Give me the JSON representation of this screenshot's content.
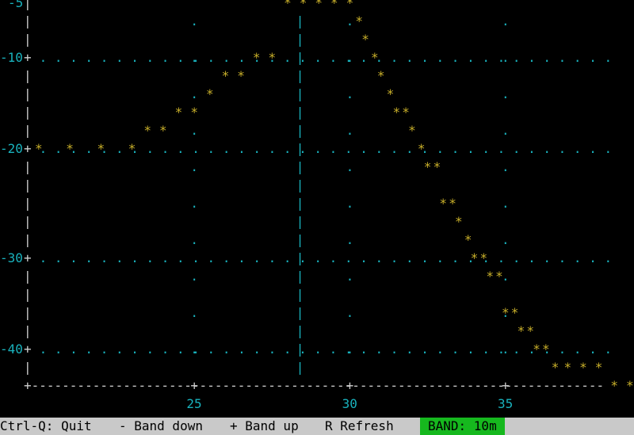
{
  "colors": {
    "background": "#000000",
    "axis": "#cfcfcf",
    "tick_labels": "#19b2bd",
    "grid_dots": "#19b2bd",
    "curve": "#c9b02a",
    "marker": "#19b2bd",
    "status_bar": "#c9c9c9",
    "band_badge": "#16b81e"
  },
  "chart_data": {
    "type": "line",
    "rendering": "ascii",
    "title": "",
    "xlabel": "",
    "ylabel": "",
    "x_ticks": [
      "25",
      "30",
      "35"
    ],
    "y_ticks": [
      "-5",
      "-10",
      "-20",
      "-30",
      "-40"
    ],
    "xlim": [
      20,
      39
    ],
    "ylim": [
      -43,
      -5
    ],
    "grid": "dotted",
    "marker_x": 28.4,
    "series": [
      {
        "x": [
          20.0,
          21.0,
          22.0,
          23.0,
          23.5,
          24.0,
          24.5,
          25.0,
          25.5,
          26.0,
          26.5,
          27.0,
          27.5,
          28.0,
          28.5,
          29.0,
          29.5,
          30.0,
          30.3,
          30.5,
          30.8,
          31.0,
          31.3,
          31.5,
          31.8,
          32.0,
          32.3,
          32.5,
          32.8,
          33.0,
          33.3,
          33.5,
          33.8,
          34.0,
          34.3,
          34.5,
          34.8,
          35.0,
          35.3,
          35.5,
          35.8,
          36.0,
          36.3,
          36.6,
          37.0,
          37.5,
          38.0,
          38.5,
          39.0
        ],
        "y": [
          -20,
          -20,
          -20,
          -19,
          -18,
          -17,
          -16,
          -15,
          -14,
          -13,
          -12,
          -11,
          -10,
          -5,
          -5,
          -5,
          -5,
          -5,
          -6,
          -8,
          -10,
          -12,
          -14,
          -15,
          -16,
          -18,
          -20,
          -21,
          -22,
          -24,
          -25,
          -26,
          -28,
          -30,
          -31,
          -32,
          -33,
          -35,
          -36,
          -37,
          -38,
          -39,
          -40,
          -41,
          -42,
          -42,
          -42,
          -43,
          -43
        ]
      }
    ]
  },
  "status_bar": {
    "quit": "Ctrl-Q: Quit",
    "band_down": "- Band down",
    "band_up": "+ Band up",
    "refresh": "R Refresh",
    "band": "BAND: 10m"
  }
}
